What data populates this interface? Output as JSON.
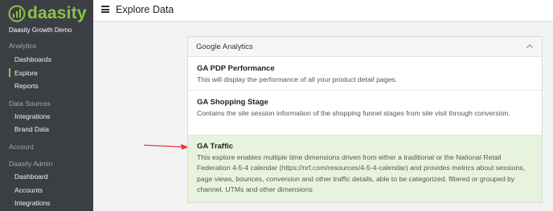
{
  "brand": {
    "name": "daasity",
    "accent": "#8bc34a"
  },
  "sidebar": {
    "org": "Daasity Growth Demo",
    "sections": [
      {
        "label": "Analytics",
        "items": [
          "Dashboards",
          "Explore",
          "Reports"
        ]
      },
      {
        "label": "Data Sources",
        "items": [
          "Integrations",
          "Brand Data"
        ]
      },
      {
        "label": "Account",
        "items": []
      },
      {
        "label": "Daasity Admin",
        "items": [
          "Dashboard",
          "Accounts",
          "Integrations"
        ]
      }
    ],
    "active_item": "Explore"
  },
  "header": {
    "title": "Explore Data",
    "menu_icon": "hamburger-icon"
  },
  "panel": {
    "title": "Google Analytics",
    "toggle_icon": "chevron-up-icon",
    "rows": [
      {
        "title": "GA PDP Performance",
        "description": "This will display the performance of all your product detail pages."
      },
      {
        "title": "GA Shopping Stage",
        "description": "Contains the site session information of the shopping funnel stages from site visit through conversion."
      },
      {
        "title": "GA Traffic",
        "description": "This explore enables multiple time dimensions driven from either a traditional or the National Retail Federation 4-5-4 calendar (https://nrf.com/resources/4-5-4-calendar) and provides metrics about sessions, page views, bounces, conversion and other traffic details, able to be categorized, filtered or grouped by channel, UTMs and other dimensions",
        "highlighted": true
      }
    ]
  },
  "annotation": {
    "icon": "arrow-right-icon",
    "color": "#e53935"
  }
}
